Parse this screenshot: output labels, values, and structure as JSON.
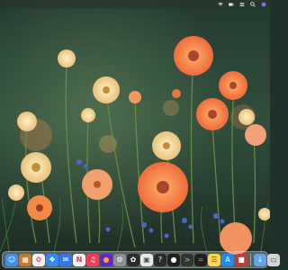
{
  "menubar": {
    "status_icons": [
      "wifi-icon",
      "battery-icon",
      "control-center-icon",
      "search-icon",
      "siri-icon"
    ]
  },
  "wallpaper": {
    "subject": "flower-field-wallpaper"
  },
  "dock": {
    "apps": [
      {
        "icon": "finder-icon",
        "color": "#3d8ef0"
      },
      {
        "icon": "launchpad-icon",
        "color": "#c47c2b"
      },
      {
        "icon": "photos-icon",
        "color": "#f2f2f2"
      },
      {
        "icon": "safari-icon",
        "color": "#2f8df2"
      },
      {
        "icon": "mail-icon",
        "color": "#3476e8"
      },
      {
        "icon": "news-icon",
        "color": "#f5f5f5"
      },
      {
        "icon": "music-icon",
        "color": "#fb3b58"
      },
      {
        "icon": "firefox-icon",
        "color": "#5b2ac7"
      },
      {
        "icon": "settings-icon",
        "color": "#8e8e93"
      },
      {
        "icon": "chatgpt-icon",
        "color": "#2a2a2a"
      },
      {
        "icon": "preview-icon",
        "color": "#e8e8e8"
      },
      {
        "icon": "help-icon",
        "color": "#2b2b2b"
      },
      {
        "icon": "user-icon",
        "color": "#1f1f1f"
      },
      {
        "icon": "terminal-icon",
        "color": "#333333"
      },
      {
        "icon": "calculator-icon",
        "color": "#1f1f1f"
      },
      {
        "icon": "notes-icon",
        "color": "#ffd84a"
      },
      {
        "icon": "app-store-icon",
        "color": "#1f8cf6"
      },
      {
        "icon": "photo-booth-icon",
        "color": "#c23b3b"
      }
    ],
    "extras": [
      {
        "icon": "downloads-icon",
        "color": "#5fa7e8"
      },
      {
        "icon": "trash-icon",
        "color": "#cfd3d8"
      }
    ]
  }
}
